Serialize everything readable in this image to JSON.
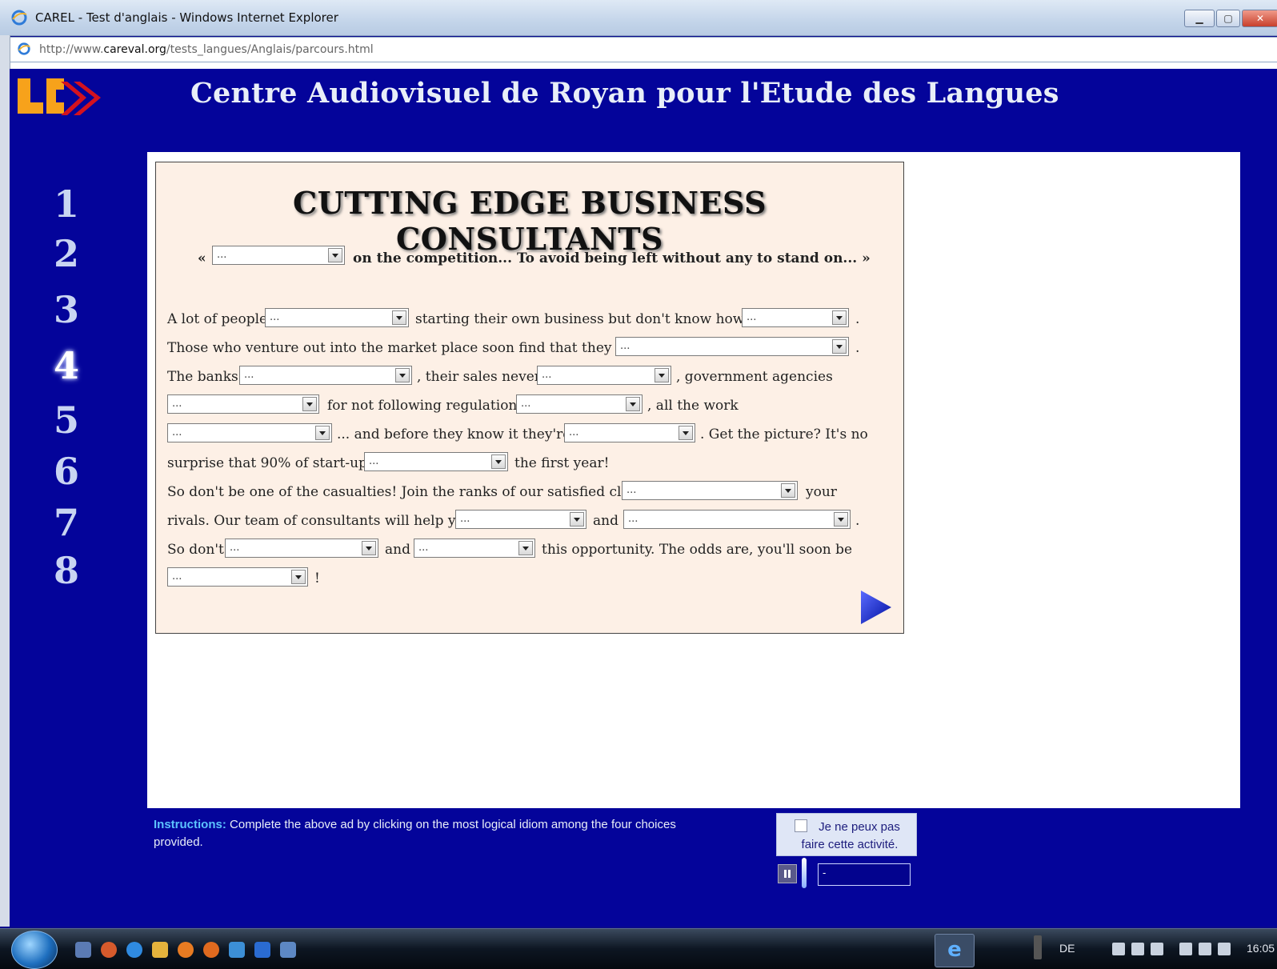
{
  "window": {
    "title": "CAREL - Test d'anglais - Windows Internet Explorer",
    "url_prefix": "http://www.",
    "url_domain": "careval.org",
    "url_path": "/tests_langues/Anglais/parcours.html"
  },
  "header": {
    "site_title": "Centre Audiovisuel de Royan pour l'Etude des Langues"
  },
  "steps": {
    "items": [
      "1",
      "2",
      "3",
      "4",
      "5",
      "6",
      "7",
      "8"
    ],
    "active": "4"
  },
  "exercise": {
    "title": "CUTTING EDGE BUSINESS CONSULTANTS",
    "quote_open": "«",
    "quote_rest": "on the competition... To avoid being left without any to stand on... »",
    "placeholder": "...",
    "lines": {
      "l1_a": "A lot of people",
      "l1_b": "starting their own business but don't know how to",
      "l1_c": ".",
      "l2_a": "Those who venture out into the market place soon find that they have",
      "l2_b": ".",
      "l3_a": "The banks",
      "l3_b": ", their sales never",
      "l3_c": ", government agencies",
      "l4_a": "for not following regulations",
      "l4_b": ", all the work",
      "l5_a": "... and before they know it they're",
      "l5_b": ". Get the picture? It's no",
      "l6_a": "surprise that 90% of start-ups",
      "l6_b": "the first year!",
      "l7_a": "So don't be one of the casualties! Join the ranks of our satisfied clients",
      "l7_b": "your",
      "l8_a": "rivals. Our team of consultants will help you",
      "l8_b": "and",
      "l8_c": ".",
      "l9_a": "So don't",
      "l9_b": "and",
      "l9_c": "this opportunity. The odds are, you'll soon be",
      "l10_a": "!"
    }
  },
  "footer": {
    "instructions_label": "Instructions:",
    "instructions_text": "Complete the above ad by clicking on the most logical idiom among the four choices provided.",
    "cannot_do": "Je ne peux pas faire cette activité.",
    "timer_value": "-"
  },
  "taskbar": {
    "language": "DE",
    "clock": "16:05"
  }
}
